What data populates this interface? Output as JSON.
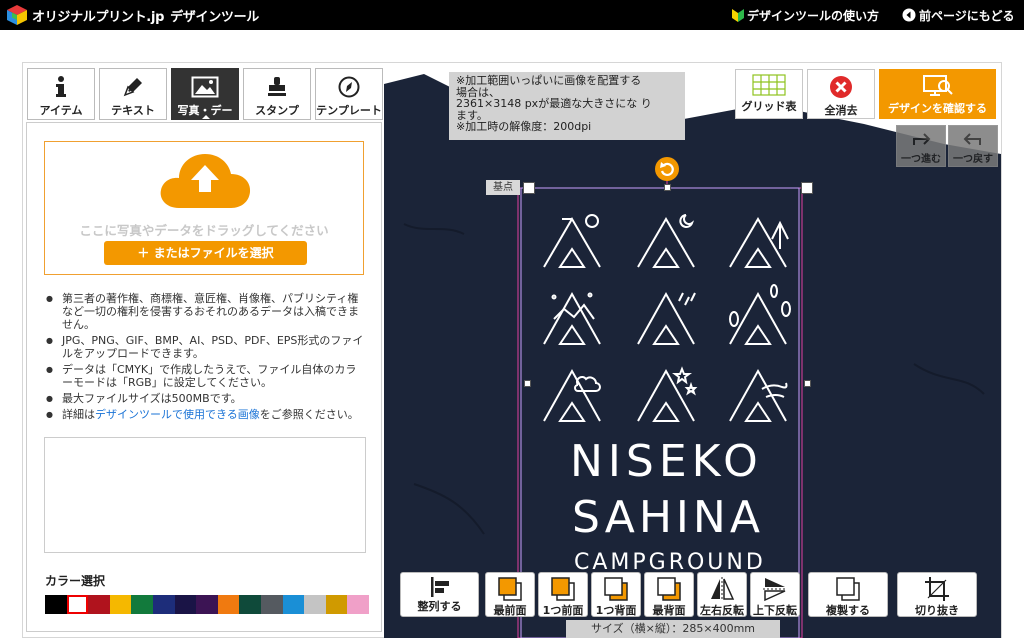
{
  "header": {
    "brand": "オリジナルプリント.jp",
    "tool_name": "デザインツール",
    "howto_link": "デザインツールの使い方",
    "back_link": "前ページにもどる"
  },
  "tabs": [
    {
      "label": "アイテム",
      "icon": "info-icon"
    },
    {
      "label": "テキスト",
      "icon": "pen-icon"
    },
    {
      "label": "写真・デー",
      "icon": "image-icon",
      "active": true
    },
    {
      "label": "スタンプ",
      "icon": "stamp-icon"
    },
    {
      "label": "テンプレート",
      "icon": "template-icon"
    }
  ],
  "upload": {
    "drop_text": "ここに写真やデータをドラッグしてください",
    "select_button": "＋ またはファイルを選択"
  },
  "notes": [
    "第三者の著作権、商標権、意匠権、肖像権、パブリシティ権など一切の権利を侵害するおそれのあるデータは入稿できません。",
    "JPG、PNG、GIF、BMP、AI、PSD、PDF、EPS形式のファイルをアップロードできます。",
    "データは「CMYK」で作成したうえで、ファイル自体のカラーモードは「RGB」に設定してください。",
    "最大ファイルサイズは500MBです。"
  ],
  "note_link": {
    "prefix": "詳細は",
    "link": "デザインツールで使用できる画像",
    "suffix": "をご参照ください。"
  },
  "color_select": {
    "title": "カラー選択",
    "swatches": [
      "#000000",
      "#ffffff",
      "#b0131d",
      "#f5b800",
      "#127a3c",
      "#1d2d7a",
      "#1a1446",
      "#3c1454",
      "#f07a10",
      "#0f4a3a",
      "#555a60",
      "#1a8fd6",
      "#c4c4c4",
      "#d09a00",
      "#f0a0c8"
    ],
    "selected_index": 1
  },
  "notice": {
    "lines": [
      "※加工範囲いっぱいに画像を配置する",
      "場合は、",
      "2361×3148 pxが最適な大きさにな り",
      "ます。",
      "※加工時の解像度：200dpi"
    ]
  },
  "right_buttons": {
    "grid": "グリッド表",
    "clear": "全消去",
    "confirm": "デザインを確認する"
  },
  "undo": {
    "forward": "一つ進む",
    "back": "一つ戻す"
  },
  "kiten": "基点",
  "design": {
    "line1": "NISEKO",
    "line2": "SAHINA",
    "line3": "CAMPGROUND"
  },
  "bottom_buttons": [
    "整列する",
    "最前面",
    "1つ前面",
    "1つ背面",
    "最背面",
    "左右反転",
    "上下反転",
    "複製する",
    "切り抜き"
  ],
  "size_label": "サイズ（横×縦）：285×400mm",
  "colors": {
    "accent": "#f39800",
    "shirt": "#1b2438",
    "topbar": "#000000"
  }
}
